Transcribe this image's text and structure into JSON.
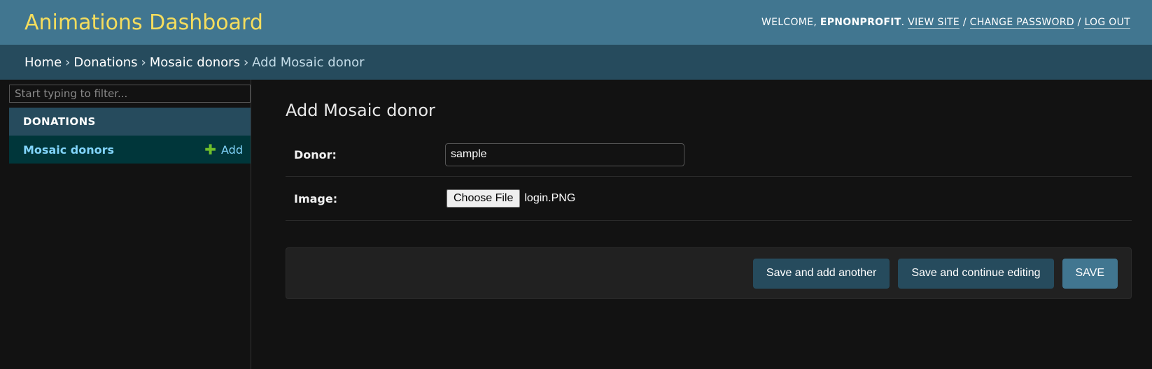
{
  "header": {
    "brand": "Animations Dashboard",
    "welcome": "WELCOME,",
    "username": "EPNONPROFIT",
    "view_site": "VIEW SITE",
    "change_password": "CHANGE PASSWORD",
    "log_out": "LOG OUT",
    "separator": "/"
  },
  "breadcrumbs": {
    "home": "Home",
    "app": "Donations",
    "model": "Mosaic donors",
    "current": "Add Mosaic donor",
    "separator": "›"
  },
  "sidebar": {
    "filter_placeholder": "Start typing to filter...",
    "app_caption": "DONATIONS",
    "models": [
      {
        "label": "Mosaic donors",
        "add_label": "Add"
      }
    ]
  },
  "main": {
    "title": "Add Mosaic donor",
    "fields": {
      "donor_label": "Donor:",
      "donor_value": "sample",
      "image_label": "Image:",
      "file_button": "Choose File",
      "file_name": "login.PNG"
    },
    "buttons": {
      "save_add_another": "Save and add another",
      "save_continue": "Save and continue editing",
      "save": "SAVE"
    }
  },
  "colors": {
    "header_bg": "#417690",
    "brand_text": "#f5dd5d",
    "breadcrumbs_bg": "#264b5d",
    "selected_row_bg": "#00363a",
    "link": "#81d4fa",
    "add_icon": "#70bf2b"
  },
  "icons": [
    "plus-icon"
  ]
}
